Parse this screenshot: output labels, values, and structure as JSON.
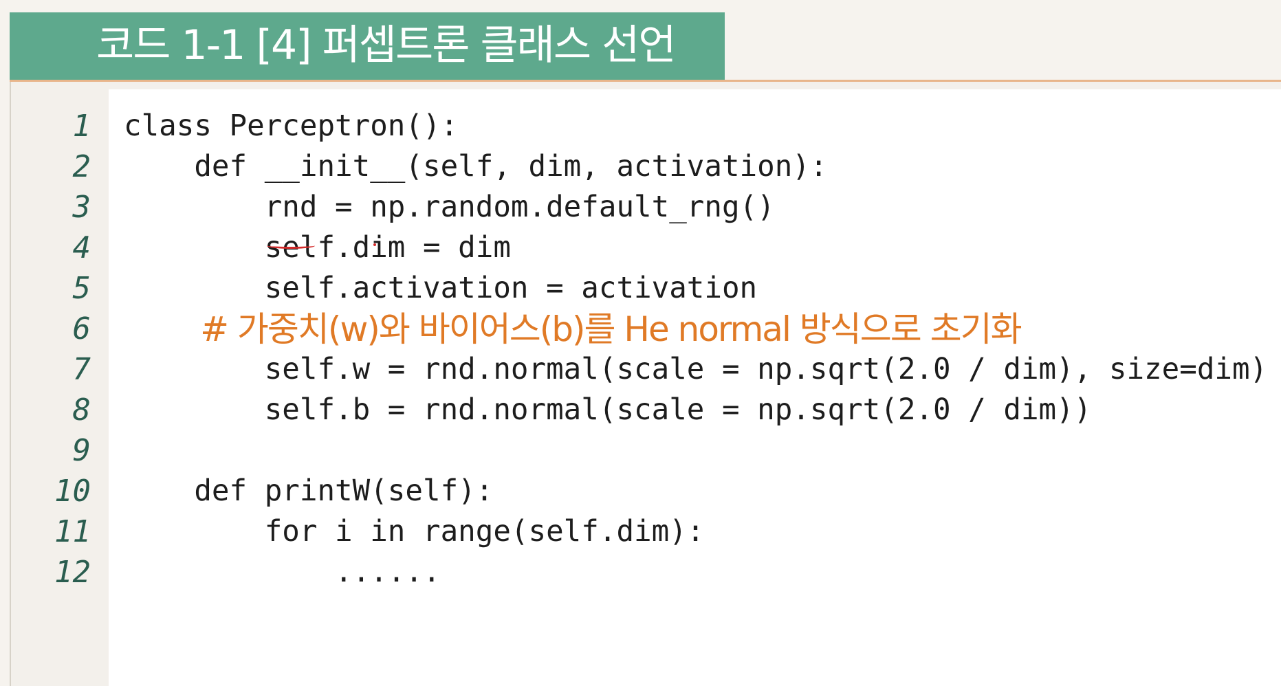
{
  "title": "코드 1-1 [4] 퍼셉트론 클래스 선언",
  "colors": {
    "title_bg": "#5ea98d",
    "accent_rule": "#e8b58a",
    "comment": "#e07a26",
    "line_number": "#2a5d4f",
    "annotation": "#d42a2a"
  },
  "lines": [
    {
      "num": "1",
      "text": "class Perceptron():",
      "type": "code"
    },
    {
      "num": "2",
      "text": "    def __init__(self, dim, activation):",
      "type": "code"
    },
    {
      "num": "3",
      "text": "        rnd = np.random.default_rng()",
      "type": "code"
    },
    {
      "num": "4",
      "text": "        self.dim = dim",
      "type": "code"
    },
    {
      "num": "5",
      "text": "        self.activation = activation",
      "type": "code"
    },
    {
      "num": "6",
      "text": "        # 가중치(w)와 바이어스(b)를 He normal 방식으로 초기화",
      "type": "comment"
    },
    {
      "num": "7",
      "text": "        self.w = rnd.normal(scale = np.sqrt(2.0 / dim), size=dim)",
      "type": "code"
    },
    {
      "num": "8",
      "text": "        self.b = rnd.normal(scale = np.sqrt(2.0 / dim))",
      "type": "code"
    },
    {
      "num": "9",
      "text": "",
      "type": "code"
    },
    {
      "num": "10",
      "text": "    def printW(self):",
      "type": "code"
    },
    {
      "num": "11",
      "text": "        for i in range(self.dim):",
      "type": "code"
    },
    {
      "num": "12",
      "text": "            ......",
      "type": "code"
    }
  ]
}
